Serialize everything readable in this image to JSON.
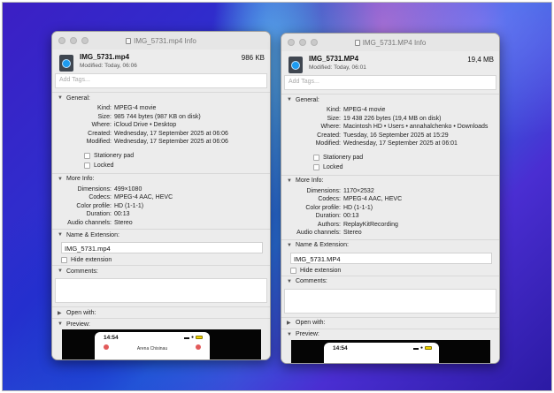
{
  "windows": [
    {
      "title": "IMG_5731.mp4 Info",
      "filename": "IMG_5731.mp4",
      "modified_short": "Modified: Today, 06:06",
      "size_short": "986 KB",
      "tags_placeholder": "Add Tags...",
      "general": {
        "label": "General:",
        "rows": [
          {
            "k": "Kind:",
            "v": "MPEG-4 movie"
          },
          {
            "k": "Size:",
            "v": "985 744 bytes (987 KB on disk)"
          },
          {
            "k": "Where:",
            "v": "iCloud Drive • Desktop"
          },
          {
            "k": "Created:",
            "v": "Wednesday, 17 September 2025 at 06:06"
          },
          {
            "k": "Modified:",
            "v": "Wednesday, 17 September 2025 at 06:06"
          }
        ],
        "stationery": "Stationery pad",
        "locked": "Locked"
      },
      "more_info": {
        "label": "More Info:",
        "rows": [
          {
            "k": "Dimensions:",
            "v": "499×1080"
          },
          {
            "k": "Codecs:",
            "v": "MPEG-4 AAC, HEVC"
          },
          {
            "k": "Color profile:",
            "v": "HD (1-1-1)"
          },
          {
            "k": "Duration:",
            "v": "00:13"
          },
          {
            "k": "Audio channels:",
            "v": "Stereo"
          }
        ]
      },
      "name_ext": {
        "label": "Name & Extension:",
        "value": "IMG_5731.mp4",
        "hide": "Hide extension"
      },
      "comments_label": "Comments:",
      "open_with_label": "Open with:",
      "preview": {
        "label": "Preview:",
        "time": "14:54",
        "caller": "Arena Chisinau"
      }
    },
    {
      "title": "IMG_5731.MP4 Info",
      "filename": "IMG_5731.MP4",
      "modified_short": "Modified: Today, 06:01",
      "size_short": "19,4 MB",
      "tags_placeholder": "Add Tags...",
      "general": {
        "label": "General:",
        "rows": [
          {
            "k": "Kind:",
            "v": "MPEG-4 movie"
          },
          {
            "k": "Size:",
            "v": "19 438 226 bytes (19,4 MB on disk)"
          },
          {
            "k": "Where:",
            "v": "Macintosh HD • Users • annahalchenko • Downloads"
          },
          {
            "k": "Created:",
            "v": "Tuesday, 16 September 2025 at 15:29"
          },
          {
            "k": "Modified:",
            "v": "Wednesday, 17 September 2025 at 06:01"
          }
        ],
        "stationery": "Stationery pad",
        "locked": "Locked"
      },
      "more_info": {
        "label": "More Info:",
        "rows": [
          {
            "k": "Dimensions:",
            "v": "1170×2532"
          },
          {
            "k": "Codecs:",
            "v": "MPEG-4 AAC, HEVC"
          },
          {
            "k": "Color profile:",
            "v": "HD (1-1-1)"
          },
          {
            "k": "Duration:",
            "v": "00:13"
          },
          {
            "k": "Authors:",
            "v": "ReplayKitRecording"
          },
          {
            "k": "Audio channels:",
            "v": "Stereo"
          }
        ]
      },
      "name_ext": {
        "label": "Name & Extension:",
        "value": "IMG_5731.MP4",
        "hide": "Hide extension"
      },
      "comments_label": "Comments:",
      "open_with_label": "Open with:",
      "preview": {
        "label": "Preview:",
        "time": "14:54",
        "caller": ""
      }
    }
  ]
}
